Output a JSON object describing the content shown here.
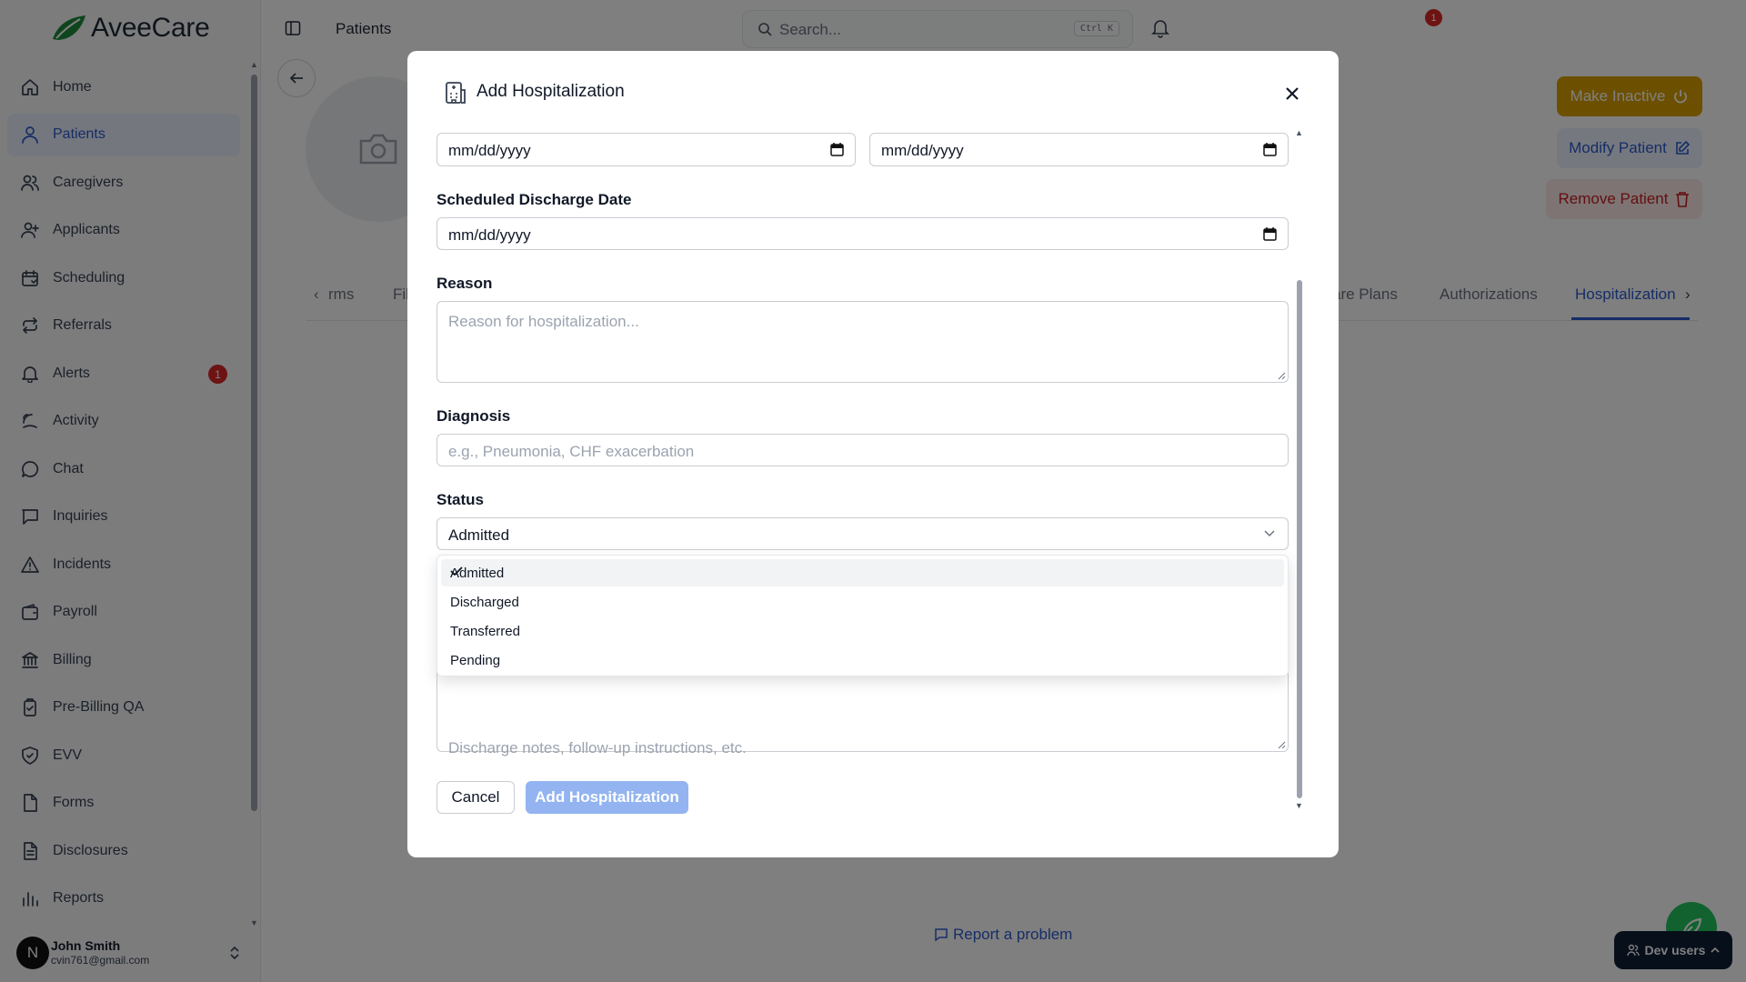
{
  "brand": {
    "name": "AveeCare",
    "accent": "#2c5bcf",
    "logo_color": "#1f8a3a"
  },
  "sidebar": {
    "items": [
      {
        "label": "Home",
        "icon": "home-icon"
      },
      {
        "label": "Patients",
        "icon": "user-icon",
        "active": true
      },
      {
        "label": "Caregivers",
        "icon": "users-icon"
      },
      {
        "label": "Applicants",
        "icon": "user-plus-icon"
      },
      {
        "label": "Scheduling",
        "icon": "calendar-icon"
      },
      {
        "label": "Referrals",
        "icon": "repeat-icon"
      },
      {
        "label": "Alerts",
        "icon": "bell-icon",
        "badge": "1"
      },
      {
        "label": "Activity",
        "icon": "activity-icon"
      },
      {
        "label": "Chat",
        "icon": "chat-icon"
      },
      {
        "label": "Inquiries",
        "icon": "message-square-icon"
      },
      {
        "label": "Incidents",
        "icon": "alert-triangle-icon"
      },
      {
        "label": "Payroll",
        "icon": "wallet-icon"
      },
      {
        "label": "Billing",
        "icon": "bank-icon"
      },
      {
        "label": "Pre-Billing QA",
        "icon": "clipboard-check-icon"
      },
      {
        "label": "EVV",
        "icon": "shield-check-icon"
      },
      {
        "label": "Forms",
        "icon": "file-icon"
      },
      {
        "label": "Disclosures",
        "icon": "file-text-icon"
      },
      {
        "label": "Reports",
        "icon": "bar-chart-icon"
      }
    ],
    "user": {
      "initial": "N",
      "name": "John Smith",
      "email": "cvin761@gmail.com"
    }
  },
  "topbar": {
    "breadcrumb": "Patients",
    "search_placeholder": "Search...",
    "search_shortcut": "Ctrl K",
    "notification_count": "1"
  },
  "patient": {
    "make_inactive": "Make Inactive",
    "modify": "Modify Patient",
    "remove": "Remove Patient",
    "tabs": [
      "rms",
      "Fil",
      "are Plans",
      "Authorizations",
      "Hospitalization"
    ]
  },
  "footer": {
    "report_problem": "Report a problem",
    "dev_users": "Dev users"
  },
  "modal": {
    "title": "Add Hospitalization",
    "admission_date_value": "mm/dd/yyyy",
    "actual_discharge_value": "mm/dd/yyyy",
    "scheduled_discharge_label": "Scheduled Discharge Date",
    "scheduled_discharge_value": "mm/dd/yyyy",
    "reason_label": "Reason",
    "reason_placeholder": "Reason for hospitalization...",
    "diagnosis_label": "Diagnosis",
    "diagnosis_placeholder": "e.g., Pneumonia, CHF exacerbation",
    "status_label": "Status",
    "status_value": "Admitted",
    "status_options": [
      "Admitted",
      "Discharged",
      "Transferred",
      "Pending"
    ],
    "notes_placeholder": "Discharge notes, follow-up instructions, etc.",
    "cancel": "Cancel",
    "submit": "Add Hospitalization"
  }
}
